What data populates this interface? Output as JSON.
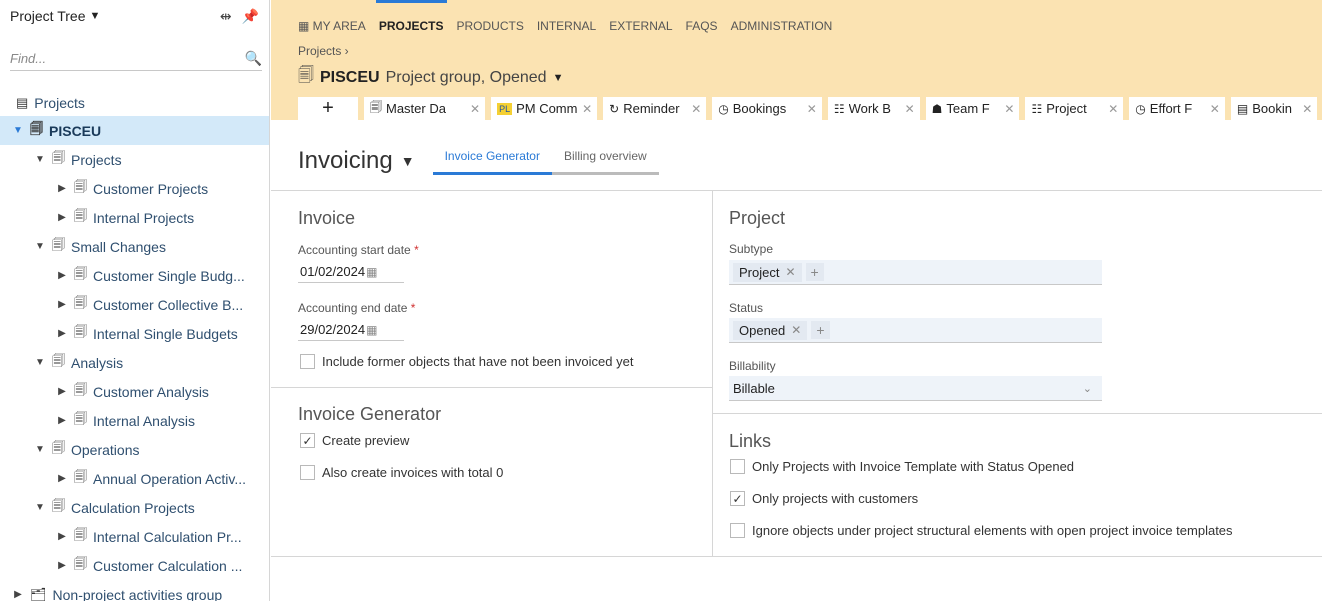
{
  "sidebar": {
    "title": "Project Tree",
    "search_placeholder": "Find...",
    "tree": [
      {
        "label": "Projects",
        "level": 0,
        "toggle": "",
        "icon": "projects-root-icon",
        "selected": false
      },
      {
        "label": "PISCEU",
        "level": 0,
        "toggle": "▼",
        "icon": "folder-icon",
        "selected": true
      },
      {
        "label": "Projects",
        "level": 1,
        "toggle": "▼",
        "icon": "folder-icon",
        "selected": false
      },
      {
        "label": "Customer Projects",
        "level": 2,
        "toggle": "▶",
        "icon": "folder-icon",
        "selected": false
      },
      {
        "label": "Internal Projects",
        "level": 2,
        "toggle": "▶",
        "icon": "folder-icon",
        "selected": false
      },
      {
        "label": "Small Changes",
        "level": 1,
        "toggle": "▼",
        "icon": "folder-icon",
        "selected": false
      },
      {
        "label": "Customer Single Budg...",
        "level": 2,
        "toggle": "▶",
        "icon": "folder-icon",
        "selected": false
      },
      {
        "label": "Customer Collective B...",
        "level": 2,
        "toggle": "▶",
        "icon": "folder-icon",
        "selected": false
      },
      {
        "label": "Internal Single Budgets",
        "level": 2,
        "toggle": "▶",
        "icon": "folder-icon",
        "selected": false
      },
      {
        "label": "Analysis",
        "level": 1,
        "toggle": "▼",
        "icon": "folder-icon",
        "selected": false
      },
      {
        "label": "Customer Analysis",
        "level": 2,
        "toggle": "▶",
        "icon": "folder-icon",
        "selected": false
      },
      {
        "label": "Internal Analysis",
        "level": 2,
        "toggle": "▶",
        "icon": "folder-icon",
        "selected": false
      },
      {
        "label": "Operations",
        "level": 1,
        "toggle": "▼",
        "icon": "folder-icon",
        "selected": false
      },
      {
        "label": "Annual Operation Activ...",
        "level": 2,
        "toggle": "▶",
        "icon": "folder-icon",
        "selected": false
      },
      {
        "label": "Calculation Projects",
        "level": 1,
        "toggle": "▼",
        "icon": "folder-icon",
        "selected": false
      },
      {
        "label": "Internal Calculation Pr...",
        "level": 2,
        "toggle": "▶",
        "icon": "folder-icon",
        "selected": false
      },
      {
        "label": "Customer Calculation ...",
        "level": 2,
        "toggle": "▶",
        "icon": "folder-icon",
        "selected": false
      },
      {
        "label": "Non-project activities group",
        "level": 0,
        "toggle": "▶",
        "icon": "folder-group-icon",
        "selected": false
      }
    ]
  },
  "menu": {
    "my_area": "MY AREA",
    "projects": "PROJECTS",
    "products": "PRODUCTS",
    "internal": "INTERNAL",
    "external": "EXTERNAL",
    "faqs": "FAQS",
    "administration": "ADMINISTRATION"
  },
  "breadcrumb": "Projects ›",
  "project": {
    "name": "PISCEU",
    "subtitle": "Project group, Opened"
  },
  "tabs": [
    {
      "label": "Master Da",
      "icon": "folder-icon"
    },
    {
      "label": "PM Comme",
      "icon": "pl-icon"
    },
    {
      "label": "Reminder",
      "icon": "reminder-icon"
    },
    {
      "label": "Bookings",
      "icon": "clock-icon"
    },
    {
      "label": "Work B",
      "icon": "structure-icon"
    },
    {
      "label": "Team F",
      "icon": "team-icon"
    },
    {
      "label": "Project",
      "icon": "structure-icon"
    },
    {
      "label": "Effort F",
      "icon": "clock-icon"
    },
    {
      "label": "Bookin",
      "icon": "booking-icon"
    }
  ],
  "main": {
    "title": "Invoicing",
    "subtab_generator": "Invoice Generator",
    "subtab_billing": "Billing overview",
    "invoice": {
      "title": "Invoice",
      "start_label": "Accounting start date",
      "start_value": "01/02/2024",
      "end_label": "Accounting end date",
      "end_value": "29/02/2024",
      "required_mark": "*",
      "include_former": "Include former objects that have not been invoiced yet"
    },
    "generator": {
      "title": "Invoice Generator",
      "create_preview": "Create preview",
      "total_zero": "Also create invoices with total 0"
    },
    "project": {
      "title": "Project",
      "subtype_label": "Subtype",
      "subtype_tag": "Project",
      "status_label": "Status",
      "status_tag": "Opened",
      "billability_label": "Billability",
      "billability_value": "Billable"
    },
    "links": {
      "title": "Links",
      "opt1": "Only Projects with Invoice Template with Status Opened",
      "opt2": "Only projects with customers",
      "opt3": "Ignore objects under project structural elements with open project invoice templates"
    }
  },
  "colors": {
    "header_bg": "#fbe3b2",
    "accent": "#2a7ad6",
    "selected_row": "#d3e9f9"
  }
}
